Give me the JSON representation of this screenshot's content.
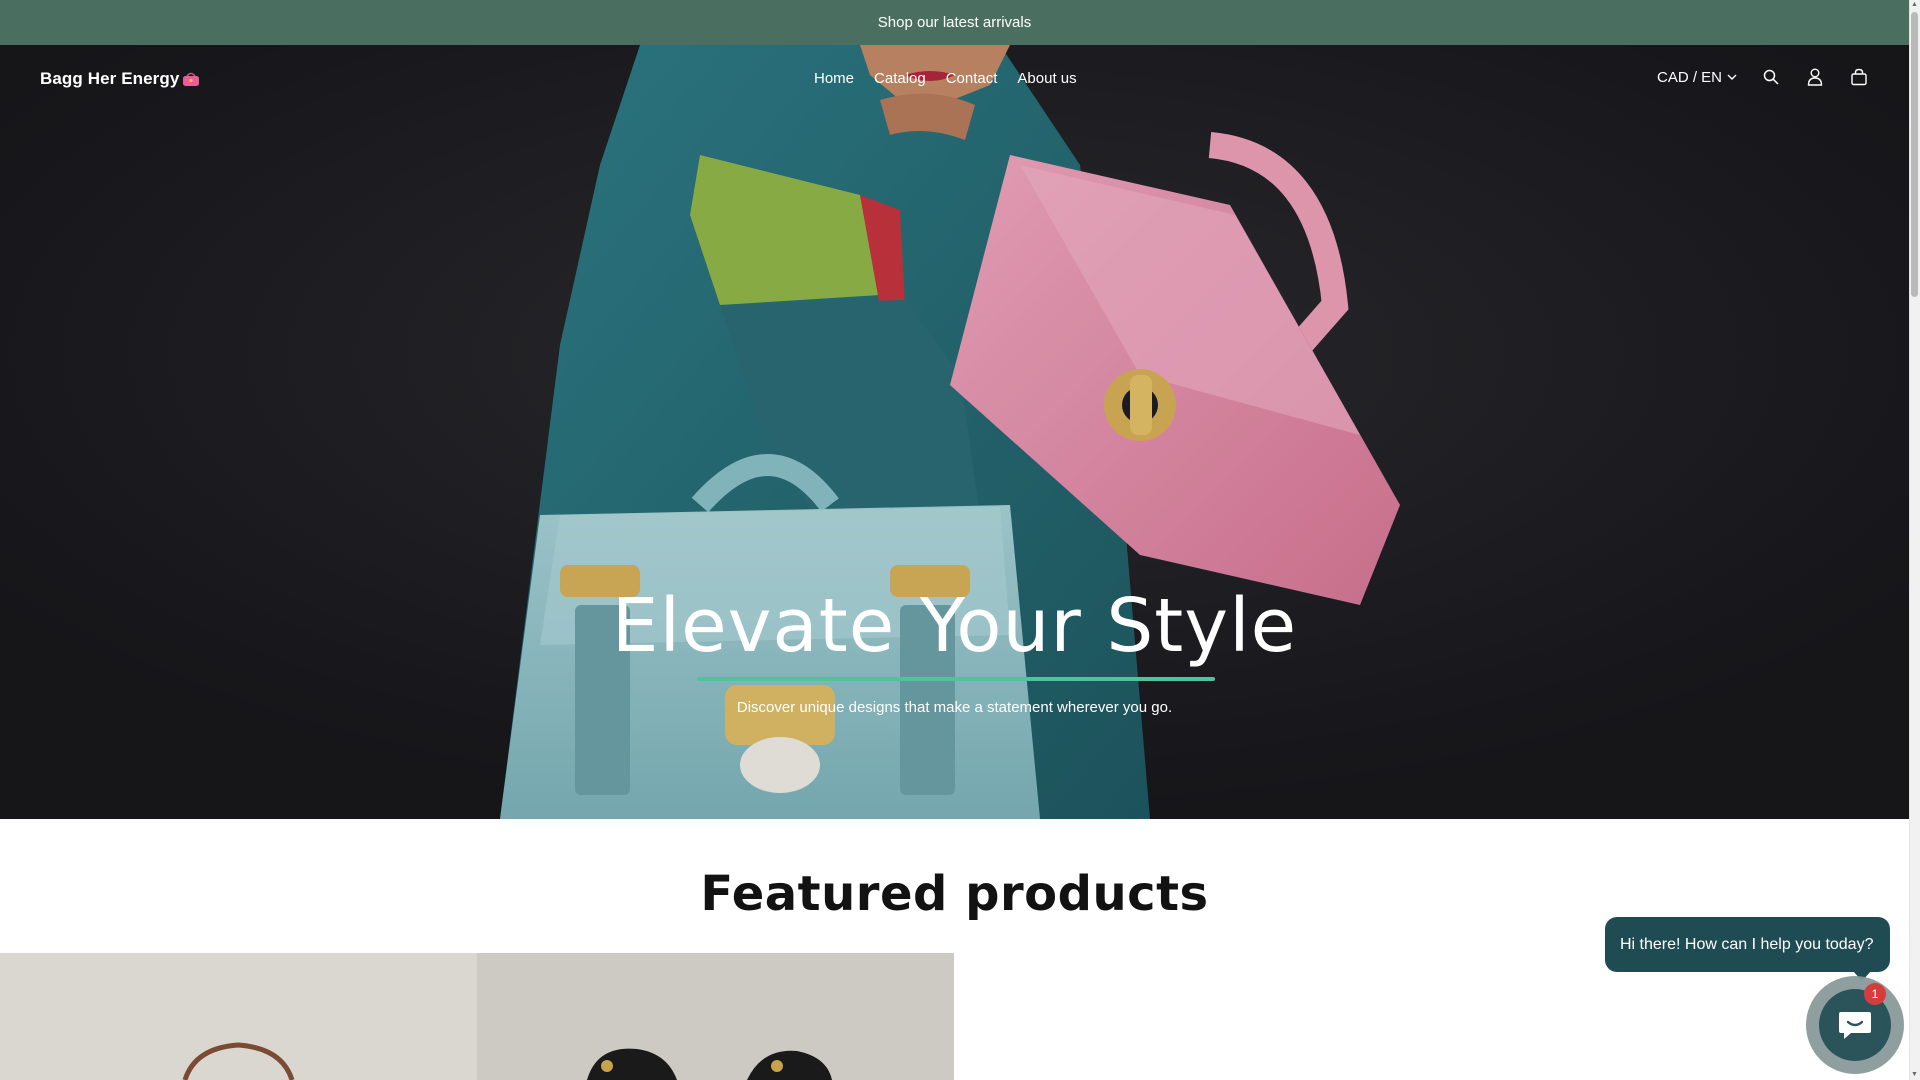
{
  "announcement": {
    "text": "Shop our latest arrivals"
  },
  "header": {
    "logo_text": "Bagg Her Energy",
    "logo_emoji": "purse-icon",
    "nav": [
      {
        "label": "Home"
      },
      {
        "label": "Catalog"
      },
      {
        "label": "Contact"
      },
      {
        "label": "About us"
      }
    ],
    "locale": "CAD / EN",
    "icons": [
      "search-icon",
      "account-icon",
      "cart-icon"
    ]
  },
  "hero": {
    "title": "Elevate Your Style",
    "subtitle": "Discover unique designs that make a statement wherever you go."
  },
  "featured": {
    "title": "Featured products"
  },
  "chat": {
    "greeting": "Hi there! How can I help you today?",
    "badge_count": "1"
  },
  "colors": {
    "announcement_bg": "#4a6f61",
    "accent_underline": "#4cc59c",
    "chat_bg": "#1f4b52",
    "badge": "#d63c3c"
  }
}
